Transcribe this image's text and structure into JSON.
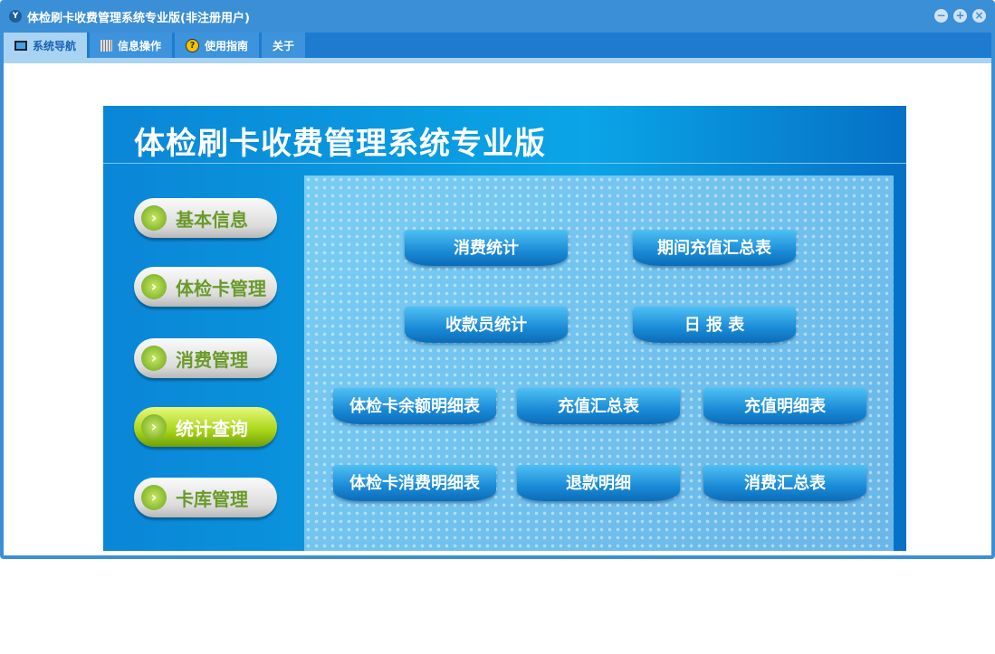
{
  "window": {
    "title": "体检刷卡收费管理系统专业版(非注册用户)",
    "logo": "YF"
  },
  "tabs": [
    {
      "label": "系统导航",
      "icon": "monitor-icon"
    },
    {
      "label": "信息操作",
      "icon": "grid-icon"
    },
    {
      "label": "使用指南",
      "icon": "help-icon"
    },
    {
      "label": "关于"
    }
  ],
  "panel": {
    "title": "体检刷卡收费管理系统专业版"
  },
  "left_menu": [
    {
      "label": "基本信息"
    },
    {
      "label": "体检卡管理"
    },
    {
      "label": "消费管理"
    },
    {
      "label": "统计查询",
      "active": true
    },
    {
      "label": "卡库管理"
    }
  ],
  "reports": [
    "消费统计",
    "期间充值汇总表",
    "收款员统计",
    "日 报 表",
    "体检卡余额明细表",
    "充值汇总表",
    "充值明细表",
    "体检卡消费明细表",
    "退款明细",
    "消费汇总表"
  ]
}
